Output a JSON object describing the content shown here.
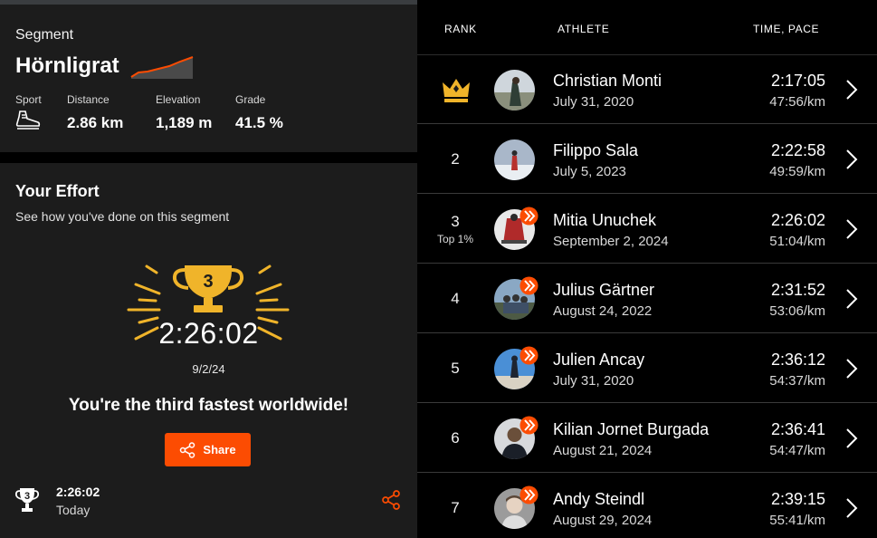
{
  "segment": {
    "kicker": "Segment",
    "name": "Hörnligrat",
    "stats": [
      {
        "label": "Sport",
        "value": "",
        "icon": "hiking-shoe-icon"
      },
      {
        "label": "Distance",
        "value": "2.86 km"
      },
      {
        "label": "Elevation",
        "value": "1,189 m"
      },
      {
        "label": "Grade",
        "value": "41.5 %"
      }
    ]
  },
  "effort": {
    "title": "Your Effort",
    "subtitle": "See how you've done on this segment",
    "trophy_rank": "3",
    "time": "2:26:02",
    "date": "9/2/24",
    "message": "You're the third fastest worldwide!",
    "share_label": "Share",
    "bottom_trophy_rank": "3",
    "bottom_time": "2:26:02",
    "bottom_when": "Today"
  },
  "leaderboard": {
    "headers": {
      "rank": "RANK",
      "athlete": "ATHLETE",
      "time": "TIME, PACE"
    },
    "rows": [
      {
        "rank": "",
        "crown": true,
        "name": "Christian Monti",
        "date": "July 31, 2020",
        "time": "2:17:05",
        "pace": "47:56/km",
        "badge": false
      },
      {
        "rank": "2",
        "name": "Filippo Sala",
        "date": "July 5, 2023",
        "time": "2:22:58",
        "pace": "49:59/km",
        "badge": false
      },
      {
        "rank": "3",
        "sub": "Top 1%",
        "name": "Mitia Unuchek",
        "date": "September 2, 2024",
        "time": "2:26:02",
        "pace": "51:04/km",
        "badge": true
      },
      {
        "rank": "4",
        "name": "Julius Gärtner",
        "date": "August 24, 2022",
        "time": "2:31:52",
        "pace": "53:06/km",
        "badge": true
      },
      {
        "rank": "5",
        "name": "Julien Ancay",
        "date": "July 31, 2020",
        "time": "2:36:12",
        "pace": "54:37/km",
        "badge": true
      },
      {
        "rank": "6",
        "name": "Kilian Jornet Burgada",
        "date": "August 21, 2024",
        "time": "2:36:41",
        "pace": "54:47/km",
        "badge": true
      },
      {
        "rank": "7",
        "name": "Andy Steindl",
        "date": "August 29, 2024",
        "time": "2:39:15",
        "pace": "55:41/km",
        "badge": true
      }
    ]
  },
  "colors": {
    "accent": "#fc4c02",
    "gold": "#f0b42a",
    "panel": "#1c1c1c"
  }
}
